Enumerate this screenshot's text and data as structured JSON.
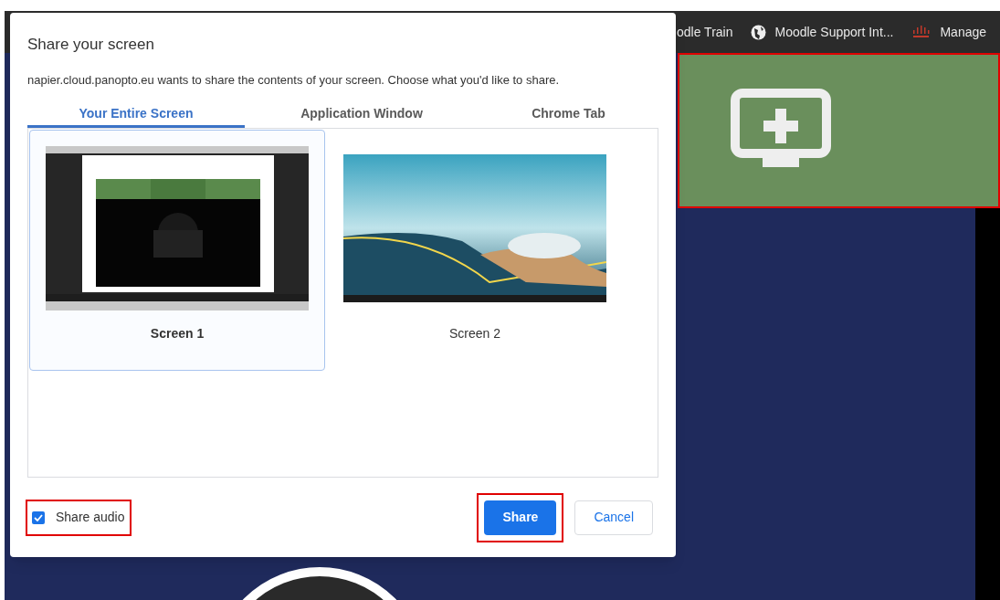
{
  "bookmarks": [
    {
      "label": "odle Train",
      "kind": "plain"
    },
    {
      "label": "Moodle Support Int...",
      "kind": "globe"
    },
    {
      "label": "Manage",
      "kind": "bars"
    }
  ],
  "add_screen_tile": {
    "highlighted": true
  },
  "dialog": {
    "title": "Share your screen",
    "message": "napier.cloud.panopto.eu wants to share the contents of your screen. Choose what you'd like to share.",
    "tabs": [
      {
        "label": "Your Entire Screen",
        "selected": true
      },
      {
        "label": "Application Window",
        "selected": false
      },
      {
        "label": "Chrome Tab",
        "selected": false
      }
    ],
    "screens": [
      {
        "label": "Screen 1",
        "selected": true,
        "kind": "picture"
      },
      {
        "label": "Screen 2",
        "selected": false,
        "kind": "picture"
      }
    ],
    "share_audio": {
      "label": "Share audio",
      "checked": true,
      "highlighted": true
    },
    "buttons": [
      {
        "label": "Share",
        "kind": "primary",
        "highlighted": true
      },
      {
        "label": "Cancel",
        "kind": "secondary",
        "highlighted": false
      }
    ]
  }
}
